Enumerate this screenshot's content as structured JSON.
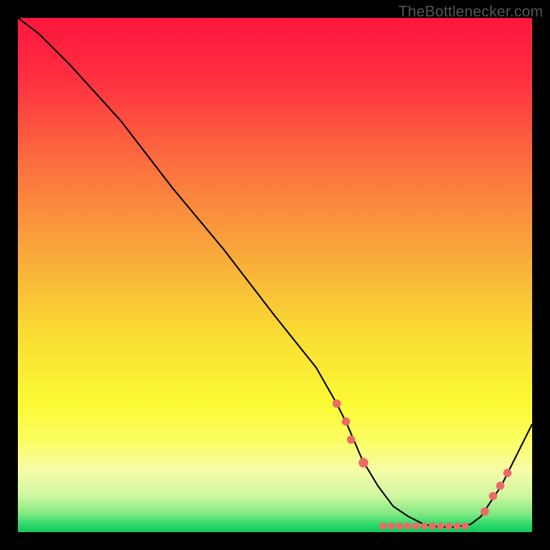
{
  "watermark": "TheBottlenecker.com",
  "chart_data": {
    "type": "line",
    "title": "",
    "xlabel": "",
    "ylabel": "",
    "xlim": [
      0,
      100
    ],
    "ylim": [
      0,
      100
    ],
    "grid": false,
    "series": [
      {
        "name": "curve",
        "x": [
          0,
          4,
          10,
          20,
          30,
          40,
          50,
          58,
          62,
          64,
          67,
          70,
          73,
          76,
          79,
          82,
          85,
          88,
          90,
          94,
          97,
          100
        ],
        "values": [
          100,
          97,
          91,
          80,
          67,
          55,
          42,
          32,
          25,
          21,
          14,
          9,
          5,
          3,
          1.5,
          1,
          1,
          1.5,
          3,
          9,
          15,
          21
        ]
      }
    ],
    "markers": [
      {
        "x": 62.0,
        "y": 25.0,
        "r": 6
      },
      {
        "x": 63.8,
        "y": 21.5,
        "r": 6
      },
      {
        "x": 64.8,
        "y": 18.0,
        "r": 6
      },
      {
        "x": 67.2,
        "y": 13.5,
        "r": 7
      },
      {
        "x": 71.0,
        "y": 1.2,
        "r": 5.2
      },
      {
        "x": 72.6,
        "y": 1.2,
        "r": 5.2
      },
      {
        "x": 74.2,
        "y": 1.2,
        "r": 5.2
      },
      {
        "x": 75.8,
        "y": 1.2,
        "r": 5.2
      },
      {
        "x": 77.4,
        "y": 1.2,
        "r": 5.2
      },
      {
        "x": 79.0,
        "y": 1.2,
        "r": 5.2
      },
      {
        "x": 80.6,
        "y": 1.2,
        "r": 5.2
      },
      {
        "x": 82.2,
        "y": 1.2,
        "r": 5.2
      },
      {
        "x": 83.8,
        "y": 1.2,
        "r": 5.2
      },
      {
        "x": 85.4,
        "y": 1.2,
        "r": 5.2
      },
      {
        "x": 87.0,
        "y": 1.2,
        "r": 5.2
      },
      {
        "x": 90.8,
        "y": 4.0,
        "r": 6
      },
      {
        "x": 92.4,
        "y": 7.0,
        "r": 6
      },
      {
        "x": 93.8,
        "y": 9.0,
        "r": 6
      },
      {
        "x": 95.2,
        "y": 11.5,
        "r": 6
      }
    ],
    "colors": {
      "line": "#000000",
      "marker": "#ED6966",
      "gradient_stops": [
        {
          "offset": 0.0,
          "color": "#FE163E"
        },
        {
          "offset": 0.12,
          "color": "#FE3040"
        },
        {
          "offset": 0.28,
          "color": "#FC6E3F"
        },
        {
          "offset": 0.45,
          "color": "#F9A63B"
        },
        {
          "offset": 0.62,
          "color": "#F9DE33"
        },
        {
          "offset": 0.75,
          "color": "#FBF935"
        },
        {
          "offset": 0.82,
          "color": "#FCFE60"
        },
        {
          "offset": 0.88,
          "color": "#F6FCA7"
        },
        {
          "offset": 0.93,
          "color": "#CFF6A1"
        },
        {
          "offset": 0.965,
          "color": "#7EE981"
        },
        {
          "offset": 0.985,
          "color": "#2ED96A"
        },
        {
          "offset": 1.0,
          "color": "#13C75C"
        }
      ]
    }
  }
}
